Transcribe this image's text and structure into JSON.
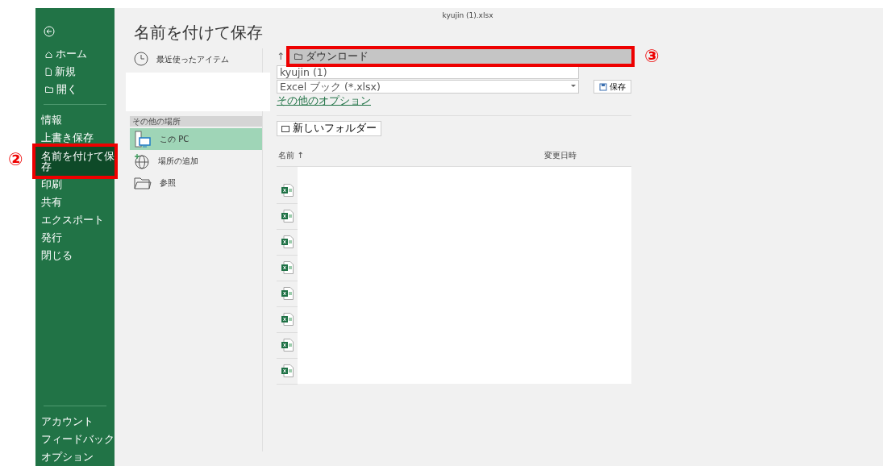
{
  "window": {
    "title": "kyujin (1).xlsx"
  },
  "sidebar": {
    "items": [
      {
        "label": "ホーム",
        "kind": "home",
        "selected": false
      },
      {
        "label": "新規",
        "kind": "new",
        "selected": false
      },
      {
        "label": "開く",
        "kind": "open",
        "selected": false
      },
      {
        "kind": "divider"
      },
      {
        "label": "情報",
        "kind": "text",
        "selected": false
      },
      {
        "label": "上書き保存",
        "kind": "text",
        "selected": false
      },
      {
        "label": "名前を付けて保存",
        "kind": "text",
        "selected": true
      },
      {
        "label": "印刷",
        "kind": "text",
        "selected": false
      },
      {
        "label": "共有",
        "kind": "text",
        "selected": false
      },
      {
        "label": "エクスポート",
        "kind": "text",
        "selected": false
      },
      {
        "label": "発行",
        "kind": "text",
        "selected": false
      },
      {
        "label": "閉じる",
        "kind": "text",
        "selected": false
      }
    ],
    "footer": [
      {
        "label": "アカウント"
      },
      {
        "label": "フィードバック"
      },
      {
        "label": "オプション"
      }
    ]
  },
  "page_title": "名前を付けて保存",
  "places": {
    "recent": {
      "label": "最近使ったアイテム"
    },
    "section_header": "その他の場所",
    "items": [
      {
        "label": "この PC",
        "kind": "pc",
        "selected": true
      },
      {
        "label": "場所の追加",
        "kind": "globe",
        "selected": false
      },
      {
        "label": "参照",
        "kind": "folder",
        "selected": false
      }
    ]
  },
  "save_panel": {
    "breadcrumb": "ダウンロード",
    "up_arrow": "↑",
    "filename": "kyujin (1)",
    "file_type": "Excel ブック (*.xlsx)",
    "save_button": "保存",
    "more_options": "その他のオプション",
    "new_folder": "新しいフォルダー",
    "columns": [
      {
        "label": "名前",
        "sort": "↑"
      },
      {
        "label": "変更日時"
      }
    ],
    "files": [
      {
        "kind": "excel"
      },
      {
        "kind": "excel"
      },
      {
        "kind": "excel"
      },
      {
        "kind": "excel"
      },
      {
        "kind": "excel"
      },
      {
        "kind": "excel"
      },
      {
        "kind": "excel"
      },
      {
        "kind": "excel"
      }
    ]
  },
  "annotations": [
    {
      "label": "②",
      "kind": "sidebar"
    },
    {
      "label": "③",
      "kind": "breadcrumb"
    }
  ]
}
